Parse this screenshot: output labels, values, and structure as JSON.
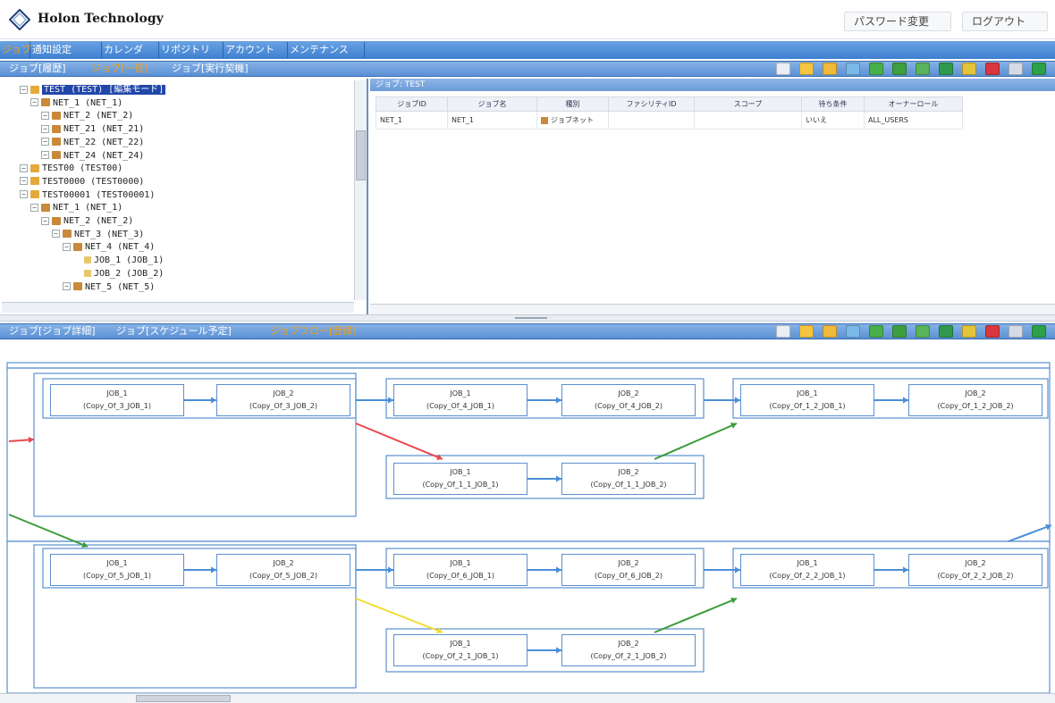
{
  "header": {
    "brand": "Holon Technology",
    "password_button": "パスワード変更",
    "logout_button": "ログアウト"
  },
  "main_menu": {
    "items": [
      "ジョブ",
      "通知設定",
      "カレンダ",
      "リポジトリ",
      "アカウント",
      "メンテナンス"
    ],
    "active_index": 0
  },
  "upper_tabs": {
    "items": [
      "ジョブ[履歴]",
      "ジョブ[一覧]",
      "ジョブ[実行契機]"
    ],
    "active_index": 1
  },
  "tree": {
    "rows": [
      {
        "label": "TEST (TEST) [編集モード]",
        "depth": 1,
        "kind": "folder",
        "selected": true
      },
      {
        "label": "NET_1 (NET_1)",
        "depth": 2,
        "kind": "net"
      },
      {
        "label": "NET_2 (NET_2)",
        "depth": 3,
        "kind": "net"
      },
      {
        "label": "NET_21 (NET_21)",
        "depth": 3,
        "kind": "net"
      },
      {
        "label": "NET_22 (NET_22)",
        "depth": 3,
        "kind": "net"
      },
      {
        "label": "NET_24 (NET_24)",
        "depth": 3,
        "kind": "net"
      },
      {
        "label": "TEST00 (TEST00)",
        "depth": 1,
        "kind": "folder"
      },
      {
        "label": "TEST0000 (TEST0000)",
        "depth": 1,
        "kind": "folder"
      },
      {
        "label": "TEST00001 (TEST00001)",
        "depth": 1,
        "kind": "folder"
      },
      {
        "label": "NET_1 (NET_1)",
        "depth": 2,
        "kind": "net"
      },
      {
        "label": "NET_2 (NET_2)",
        "depth": 3,
        "kind": "net"
      },
      {
        "label": "NET_3 (NET_3)",
        "depth": 4,
        "kind": "net"
      },
      {
        "label": "NET_4 (NET_4)",
        "depth": 5,
        "kind": "net"
      },
      {
        "label": "JOB_1 (JOB_1)",
        "depth": 6,
        "kind": "job"
      },
      {
        "label": "JOB_2 (JOB_2)",
        "depth": 6,
        "kind": "job"
      },
      {
        "label": "NET_5 (NET_5)",
        "depth": 5,
        "kind": "net"
      }
    ]
  },
  "list": {
    "title": "ジョブ: TEST",
    "columns": [
      "ジョブID",
      "ジョブ名",
      "種別",
      "ファシリティID",
      "スコープ",
      "待ち条件",
      "オーナーロール"
    ],
    "rows": [
      [
        "NET_1",
        "NET_1",
        "ジョブネット",
        "",
        "",
        "いいえ",
        "ALL_USERS"
      ]
    ]
  },
  "lower_tabs": {
    "items": [
      "ジョブ[ジョブ詳細]",
      "ジョブ[スケジュール予定]",
      "ジョブフロー[登録]"
    ],
    "active_index": 2
  },
  "flow": {
    "jobs": [
      {
        "name": "JOB_1",
        "copy": "(Copy_Of_3_JOB_1)"
      },
      {
        "name": "JOB_2",
        "copy": "(Copy_Of_3_JOB_2)"
      },
      {
        "name": "JOB_1",
        "copy": "(Copy_Of_4_JOB_1)"
      },
      {
        "name": "JOB_2",
        "copy": "(Copy_Of_4_JOB_2)"
      },
      {
        "name": "JOB_1",
        "copy": "(Copy_Of_1_2_JOB_1)"
      },
      {
        "name": "JOB_2",
        "copy": "(Copy_Of_1_2_JOB_2)"
      },
      {
        "name": "JOB_1",
        "copy": "(Copy_Of_1_1_JOB_1)"
      },
      {
        "name": "JOB_2",
        "copy": "(Copy_Of_1_1_JOB_2)"
      },
      {
        "name": "JOB_1",
        "copy": "(Copy_Of_5_JOB_1)"
      },
      {
        "name": "JOB_2",
        "copy": "(Copy_Of_5_JOB_2)"
      },
      {
        "name": "JOB_1",
        "copy": "(Copy_Of_6_JOB_1)"
      },
      {
        "name": "JOB_2",
        "copy": "(Copy_Of_6_JOB_2)"
      },
      {
        "name": "JOB_1",
        "copy": "(Copy_Of_2_2_JOB_1)"
      },
      {
        "name": "JOB_2",
        "copy": "(Copy_Of_2_2_JOB_2)"
      },
      {
        "name": "JOB_1",
        "copy": "(Copy_Of_2_1_JOB_1)"
      },
      {
        "name": "JOB_2",
        "copy": "(Copy_Of_2_1_JOB_2)"
      }
    ]
  },
  "colors": {
    "menu_blue": "#3d7fd0",
    "active_tab": "#f39c12",
    "selection": "#2147a8",
    "edge_blue": "#4a8fd8",
    "edge_red": "#e8484e",
    "edge_green": "#3a9b3a",
    "edge_yellow": "#f2dc2a"
  },
  "toolbar_icons": [
    "edit-icon",
    "folder-icon",
    "copy-icon",
    "refresh-icon",
    "run-icon",
    "run-now-icon",
    "skip-icon",
    "hold-icon",
    "pencil-icon",
    "delete-icon",
    "settings-icon",
    "play-icon"
  ]
}
